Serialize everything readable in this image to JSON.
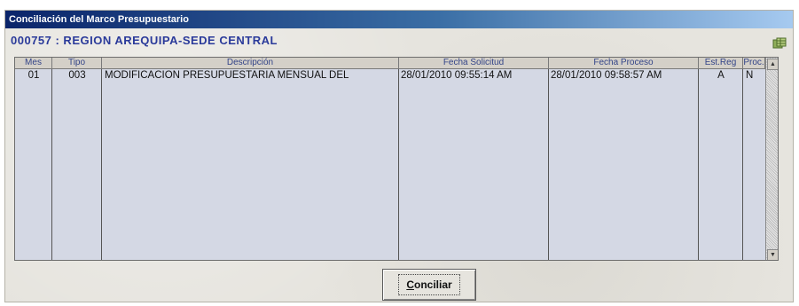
{
  "window": {
    "title": "Conciliación del Marco Presupuestario"
  },
  "entity": {
    "label": "000757 : REGION AREQUIPA-SEDE CENTRAL"
  },
  "corner_button": {
    "icon": "table-export-icon"
  },
  "grid": {
    "columns": [
      "Mes",
      "Tipo",
      "Descripción",
      "Fecha Solicitud",
      "Fecha Proceso",
      "Est.Reg",
      "Proc."
    ],
    "rows": [
      {
        "mes": "01",
        "tipo": "003",
        "descripcion": "MODIFICACION PRESUPUESTARIA MENSUAL DEL",
        "fecha_solicitud": "28/01/2010 09:55:14 AM",
        "fecha_proceso": "28/01/2010 09:58:57 AM",
        "est_reg": "A",
        "proc": "N"
      }
    ]
  },
  "actions": {
    "conciliar_mnemonic": "C",
    "conciliar_rest": "onciliar"
  },
  "colors": {
    "title_start": "#0a246a",
    "title_end": "#a6caf0",
    "entity_text": "#2a3a9a",
    "grid_bg": "#d4d8e4"
  }
}
